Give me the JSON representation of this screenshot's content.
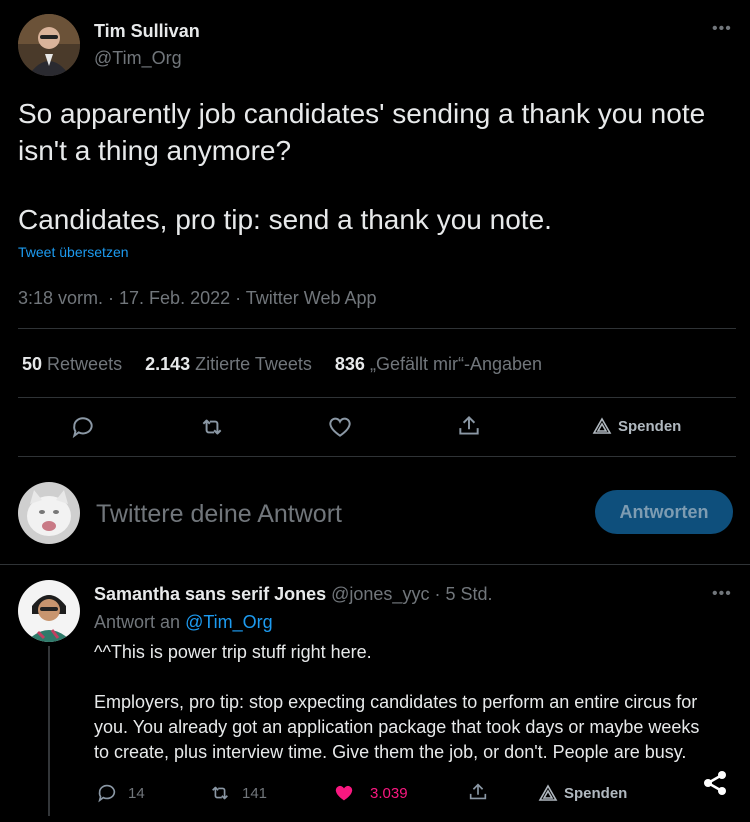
{
  "tweet": {
    "author_name": "Tim Sullivan",
    "author_handle": "@Tim_Org",
    "text_line1": "So apparently job candidates' sending a thank you note",
    "text_line2": "isn't a thing anymore?",
    "text_line3": "Candidates, pro tip: send a thank you note.",
    "translate_link": "Tweet übersetzen",
    "meta": "3:18 vorm. · 17. Feb. 2022 · Twitter Web App",
    "stats": {
      "retweets_count": "50",
      "retweets_label": "Retweets",
      "quotes_count": "2.143",
      "quotes_label": "Zitierte Tweets",
      "likes_count": "836",
      "likes_label": "„Gefällt mir“-Angaben"
    },
    "actions": {
      "donate_label": "Spenden"
    }
  },
  "composer": {
    "placeholder": "Twittere deine Antwort",
    "reply_button": "Antworten"
  },
  "reply": {
    "author_name": "Samantha sans serif Jones",
    "author_handle": "@jones_yyc",
    "time": "· 5 Std.",
    "replying_to_prefix": "Antwort an",
    "replying_to_handle": "@Tim_Org",
    "text_line1": "^^This is power trip stuff right here.",
    "text_line2": "Employers, pro tip: stop expecting candidates to perform an entire circus for",
    "text_line3": "you. You already got an application package that took days or maybe weeks",
    "text_line4": "to create, plus interview time. Give them the job, or don't. People are busy.",
    "actions": {
      "reply_count": "14",
      "retweet_count": "141",
      "like_count": "3.039",
      "donate_label": "Spenden"
    }
  },
  "colors": {
    "background": "#000000",
    "text": "#e7e9ea",
    "muted": "#71767b",
    "link": "#1d9bf0",
    "like_active": "#f91880",
    "reply_button_bg": "#0e4f7c"
  }
}
